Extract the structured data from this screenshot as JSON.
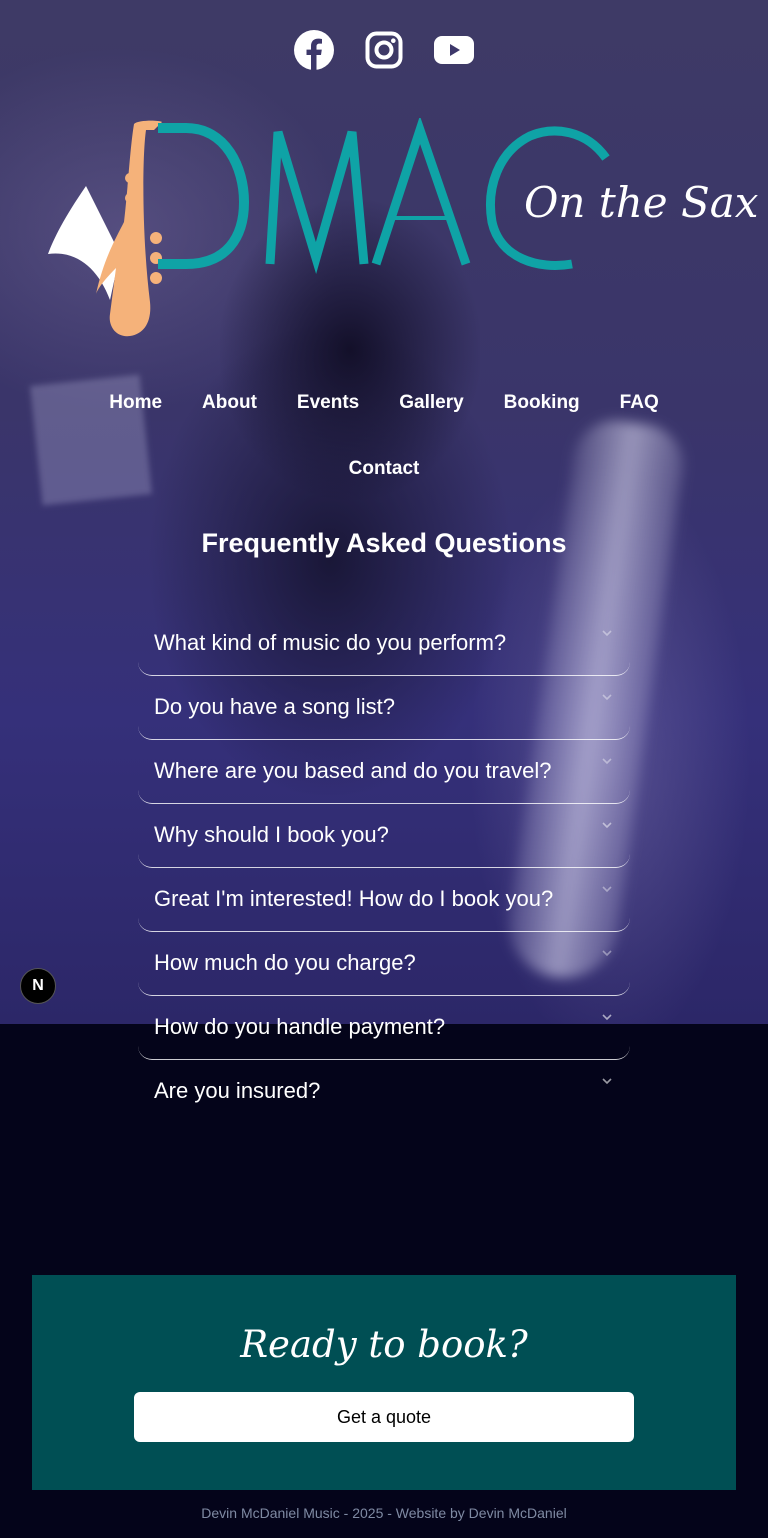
{
  "social": {
    "icons": [
      "facebook-icon",
      "instagram-icon",
      "youtube-icon"
    ]
  },
  "logo": {
    "wordmark": "DMAC",
    "tagline": "On the Sax",
    "colors": {
      "teal": "#0fa3a6",
      "sax": "#f5b27a"
    }
  },
  "nav": {
    "items": [
      {
        "label": "Home"
      },
      {
        "label": "About"
      },
      {
        "label": "Events"
      },
      {
        "label": "Gallery"
      },
      {
        "label": "Booking"
      },
      {
        "label": "FAQ"
      },
      {
        "label": "Contact"
      }
    ]
  },
  "faq": {
    "title": "Frequently Asked Questions",
    "questions": [
      "What kind of music do you perform?",
      "Do you have a song list?",
      "Where are you based and do you travel?",
      "Why should I book you?",
      "Great I'm interested! How do I book you?",
      "How much do you charge?",
      "How do you handle payment?",
      "Are you insured?"
    ]
  },
  "badge": {
    "letter": "N"
  },
  "cta": {
    "heading": "Ready to book?",
    "button_label": "Get a quote",
    "background": "#004f54"
  },
  "footer": {
    "text": "Devin McDaniel Music - 2025 - Website by Devin McDaniel"
  }
}
